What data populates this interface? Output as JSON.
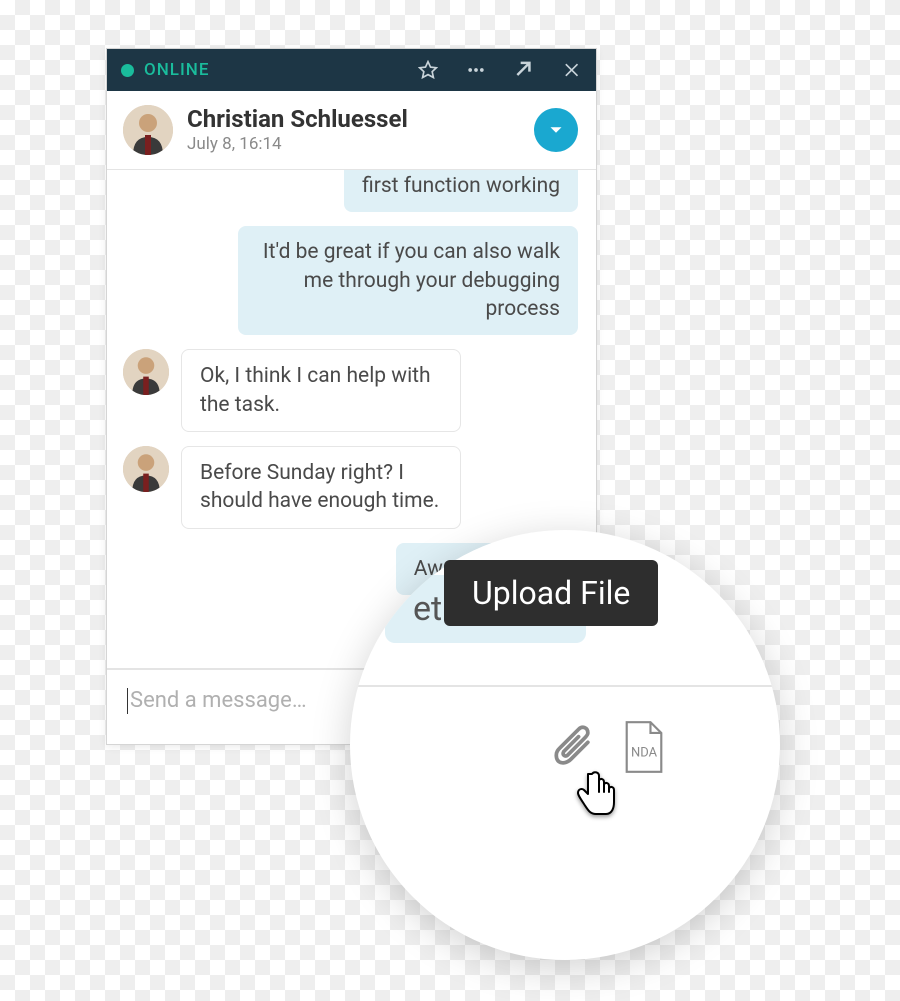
{
  "status": {
    "label": "ONLINE",
    "color": "#1abc9c"
  },
  "header": {
    "name": "Christian Schluessel",
    "timestamp": "July 8, 16:14"
  },
  "messages": [
    {
      "side": "right",
      "style": "blue cutoff",
      "text": "first function working"
    },
    {
      "side": "right",
      "style": "blue",
      "text": "It'd be great if you can also walk me through your debugging process"
    },
    {
      "side": "left",
      "style": "white",
      "text": "Ok, I think I can help with the task."
    },
    {
      "side": "left",
      "style": "white",
      "text": "Before Sunday right? I should have enough time."
    },
    {
      "side": "right",
      "style": "blue",
      "text": "Awesome! Let's"
    }
  ],
  "composer": {
    "placeholder": "Send a message…"
  },
  "zoom": {
    "bubble_fragment": "et started",
    "tooltip": "Upload File",
    "nda_label": "NDA"
  },
  "icons": {
    "star": "star-icon",
    "more": "more-icon",
    "popout": "popout-icon",
    "close": "close-icon",
    "expand": "chevron-down-icon",
    "paperclip": "paperclip-icon",
    "nda_doc": "nda-document-icon"
  }
}
